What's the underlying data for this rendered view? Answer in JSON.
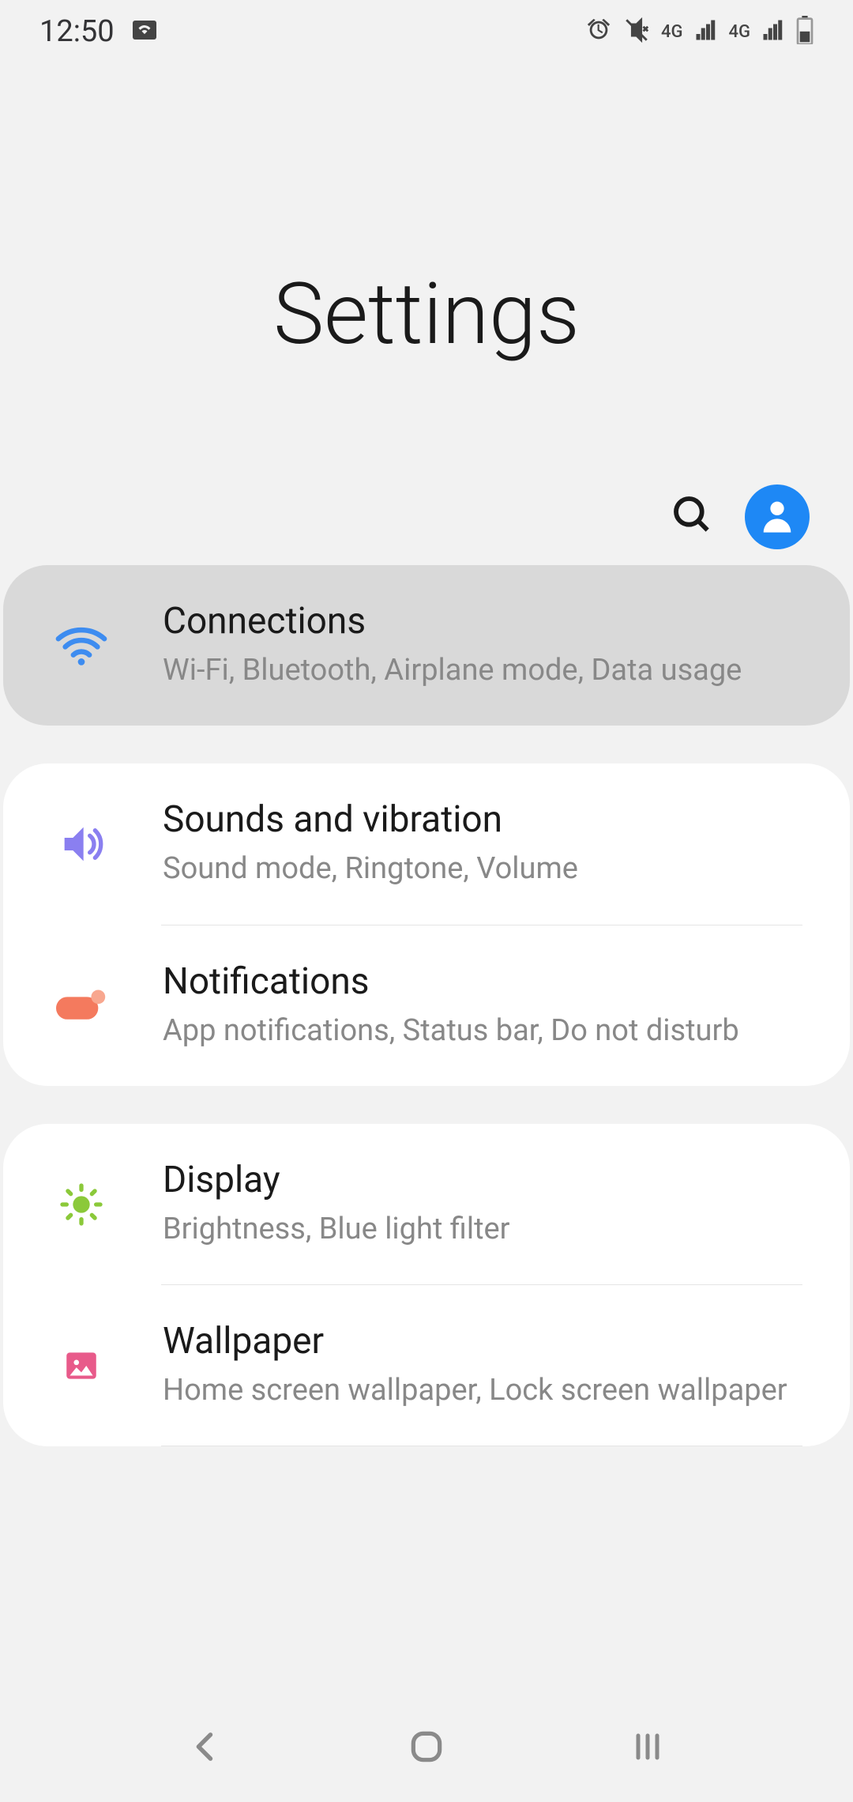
{
  "status": {
    "time": "12:50",
    "network1": "4G",
    "network2": "4G"
  },
  "header": {
    "title": "Settings"
  },
  "items": {
    "connections": {
      "title": "Connections",
      "subtitle": "Wi-Fi, Bluetooth, Airplane mode, Data usage"
    },
    "sounds": {
      "title": "Sounds and vibration",
      "subtitle": "Sound mode, Ringtone, Volume"
    },
    "notifications": {
      "title": "Notifications",
      "subtitle": "App notifications, Status bar, Do not disturb"
    },
    "display": {
      "title": "Display",
      "subtitle": "Brightness, Blue light filter"
    },
    "wallpaper": {
      "title": "Wallpaper",
      "subtitle": "Home screen wallpaper, Lock screen wallpaper"
    }
  }
}
